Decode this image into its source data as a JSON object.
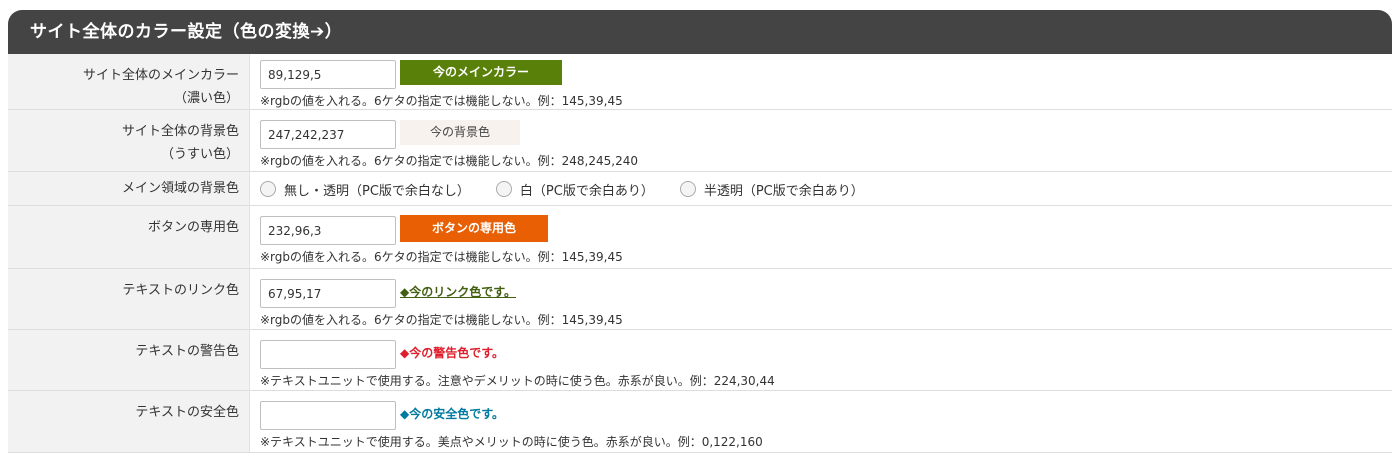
{
  "header": {
    "title": "サイト全体のカラー設定（色の変換➔）"
  },
  "colors": {
    "main": "#59810a",
    "bg": "#f7f2ed",
    "button": "#e86003",
    "link": "#435f11",
    "warning": "#e01e2c",
    "safe": "#007aa0"
  },
  "rows": {
    "main_color": {
      "label1": "サイト全体のメインカラー",
      "label2": "（濃い色）",
      "value": "89,129,5",
      "swatch": "今のメインカラー",
      "note": "※rgbの値を入れる。6ケタの指定では機能しない。例：145,39,45"
    },
    "bg_color": {
      "label1": "サイト全体の背景色",
      "label2": "（うすい色）",
      "value": "247,242,237",
      "swatch": "今の背景色",
      "note": "※rgbの値を入れる。6ケタの指定では機能しない。例：248,245,240"
    },
    "main_area_bg": {
      "label": "メイン領域の背景色",
      "options": [
        "無し・透明（PC版で余白なし）",
        "白（PC版で余白あり）",
        "半透明（PC版で余白あり）"
      ]
    },
    "button_color": {
      "label": "ボタンの専用色",
      "value": "232,96,3",
      "swatch": "ボタンの専用色",
      "note": "※rgbの値を入れる。6ケタの指定では機能しない。例：145,39,45"
    },
    "link_color": {
      "label": "テキストのリンク色",
      "value": "67,95,17",
      "sample": "◆今のリンク色です。",
      "note": "※rgbの値を入れる。6ケタの指定では機能しない。例：145,39,45"
    },
    "warning_color": {
      "label": "テキストの警告色",
      "value": "",
      "sample": "◆今の警告色です。",
      "note": "※テキストユニットで使用する。注意やデメリットの時に使う色。赤系が良い。例：224,30,44"
    },
    "safe_color": {
      "label": "テキストの安全色",
      "value": "",
      "sample": "◆今の安全色です。",
      "note": "※テキストユニットで使用する。美点やメリットの時に使う色。赤系が良い。例：0,122,160"
    }
  }
}
